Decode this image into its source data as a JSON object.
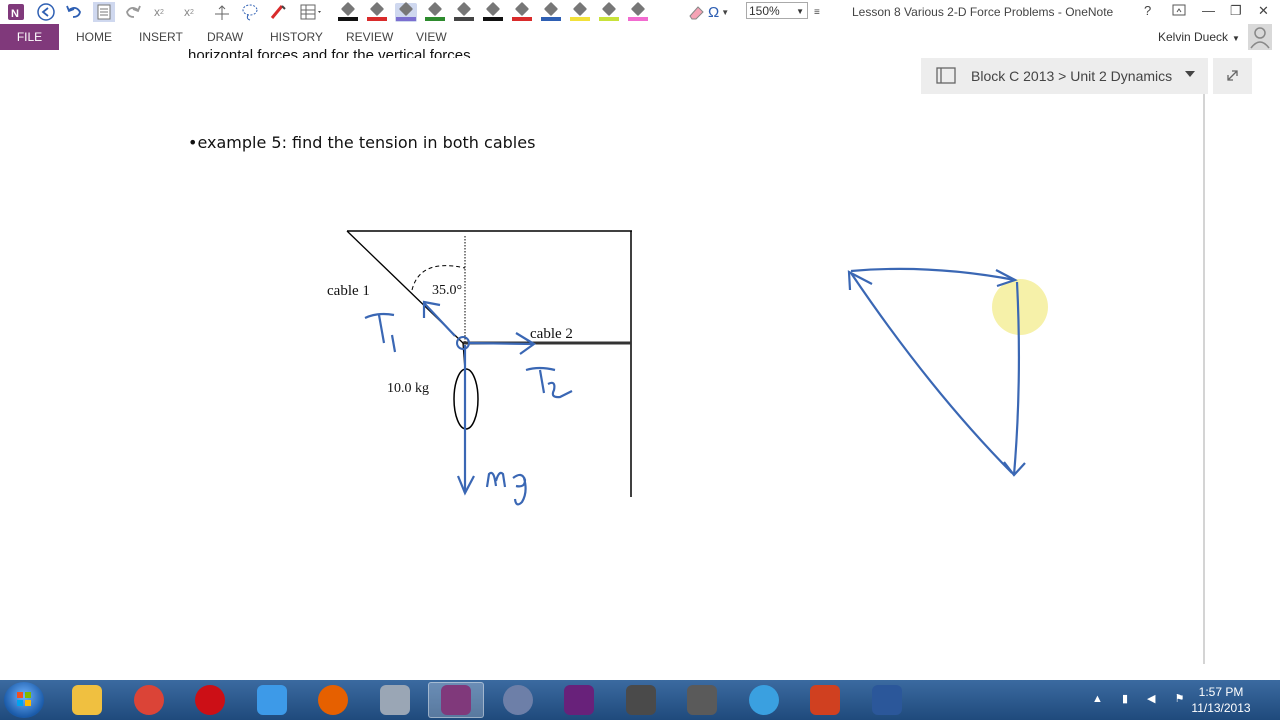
{
  "window": {
    "title": "Lesson 8 Various 2-D Force Problems - OneNote",
    "zoom": "150%",
    "help": "?",
    "minimize": "—",
    "restore": "❐",
    "close": "✕"
  },
  "qat": {
    "icons": [
      "onenote-logo-icon",
      "back-icon",
      "undo-icon",
      "dock-icon",
      "redo-icon",
      "subscript-icon",
      "superscript-icon",
      "insert-space-icon",
      "lasso-icon",
      "eraser-pen-icon",
      "table-icon"
    ],
    "pens": [
      "#111111",
      "#d92b2b",
      "#7b6fd0",
      "#2e8b2e",
      "#444444",
      "#111111",
      "#d92b2b",
      "#2e5fb3",
      "#f2e13a",
      "#c8e23a",
      "#f26bd0"
    ],
    "selected_pen": 2,
    "symbol_glyph": "Ω"
  },
  "ribbon": {
    "file": "FILE",
    "tabs": [
      "HOME",
      "INSERT",
      "DRAW",
      "HISTORY",
      "REVIEW",
      "VIEW"
    ],
    "user": "Kelvin Dueck"
  },
  "notebook_nav": {
    "path": "Block C 2013 > Unit 2 Dynamics"
  },
  "note": {
    "cut_line": "horizontal forces and for the vertical forces",
    "example": "•example 5: find the tension in both cables",
    "figure": {
      "cable1": "cable 1",
      "cable2": "cable 2",
      "angle": "35.0°",
      "mass": "10.0 kg"
    },
    "ink": {
      "t1": "T₁",
      "t2": "T₂",
      "mg": "mg"
    }
  },
  "taskbar": {
    "apps": [
      "explorer",
      "chrome",
      "opera",
      "dropbox",
      "firefox",
      "scanner",
      "onenote",
      "dashboard",
      "visual-studio",
      "calculator",
      "flash",
      "itunes",
      "maple",
      "word"
    ],
    "active_index": 6,
    "time": "1:57 PM",
    "date": "11/13/2013"
  }
}
